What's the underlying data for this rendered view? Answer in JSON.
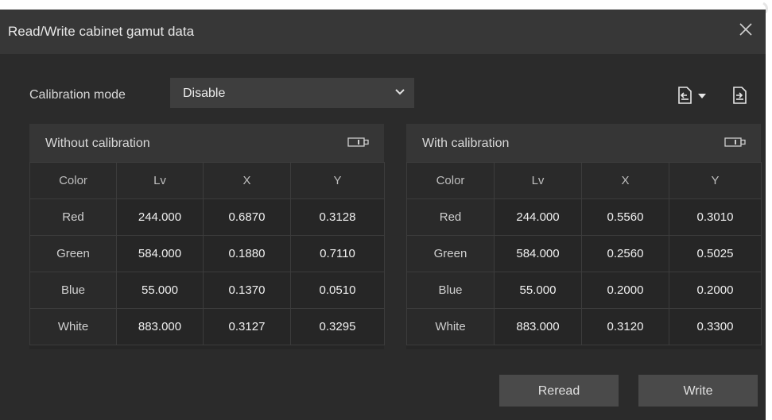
{
  "window": {
    "title": "Read/Write cabinet gamut data"
  },
  "calibration": {
    "label": "Calibration mode",
    "selected": "Disable"
  },
  "toolbar": {
    "import_icon": "file-import-icon",
    "export_icon": "file-export-icon"
  },
  "panels": [
    {
      "title": "Without calibration",
      "columns": [
        "Color",
        "Lv",
        "X",
        "Y"
      ],
      "rows": [
        [
          "Red",
          "244.000",
          "0.6870",
          "0.3128"
        ],
        [
          "Green",
          "584.000",
          "0.1880",
          "0.7110"
        ],
        [
          "Blue",
          "55.000",
          "0.1370",
          "0.0510"
        ],
        [
          "White",
          "883.000",
          "0.3127",
          "0.3295"
        ]
      ]
    },
    {
      "title": "With calibration",
      "columns": [
        "Color",
        "Lv",
        "X",
        "Y"
      ],
      "rows": [
        [
          "Red",
          "244.000",
          "0.5560",
          "0.3010"
        ],
        [
          "Green",
          "584.000",
          "0.2560",
          "0.5025"
        ],
        [
          "Blue",
          "55.000",
          "0.2000",
          "0.2000"
        ],
        [
          "White",
          "883.000",
          "0.3120",
          "0.3300"
        ]
      ]
    }
  ],
  "actions": {
    "reread": "Reread",
    "write": "Write"
  },
  "colors": {
    "dialog_bg": "#2b2b2b",
    "titlebar_bg": "#373737",
    "text": "#e8e8e8"
  }
}
